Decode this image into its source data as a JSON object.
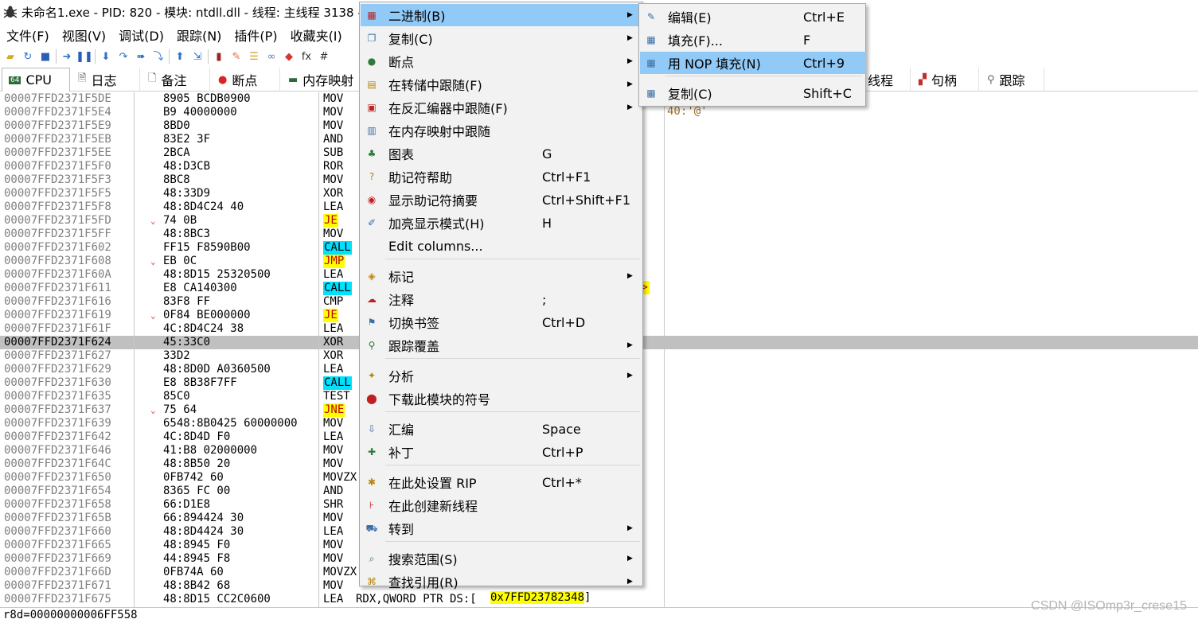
{
  "window": {
    "title": "未命名1.exe - PID: 820 - 模块: ntdll.dll - 线程: 主线程 3138 -",
    "icon": "bug-icon"
  },
  "menubar": [
    "文件(F)",
    "视图(V)",
    "调试(D)",
    "跟踪(N)",
    "插件(P)",
    "收藏夹(I)"
  ],
  "toolbar": [
    {
      "icon": "open-folder-icon",
      "glyph": "▰",
      "color": "#d9a82b"
    },
    {
      "icon": "restart-icon",
      "glyph": "↻",
      "color": "#2a73c9"
    },
    {
      "icon": "stop-icon",
      "glyph": "■",
      "color": "#2a5fb6"
    },
    {
      "icon": "run-icon",
      "glyph": "➜",
      "color": "#2a73c9"
    },
    {
      "icon": "pause-icon",
      "glyph": "❚❚",
      "color": "#2a5fb6"
    },
    {
      "icon": "step-into-icon",
      "glyph": "⬇",
      "color": "#2a73c9"
    },
    {
      "icon": "step-over-icon",
      "glyph": "↷",
      "color": "#2a73c9"
    },
    {
      "icon": "trace-into-icon",
      "glyph": "➠",
      "color": "#2a73c9"
    },
    {
      "icon": "trace-over-icon",
      "glyph": "⤵",
      "color": "#2a73c9"
    },
    {
      "icon": "execute-till-return-icon",
      "glyph": "⬆",
      "color": "#2a73c9"
    },
    {
      "icon": "run-to-user-code-icon",
      "glyph": "⇲",
      "color": "#2a73c9"
    },
    {
      "icon": "script-icon",
      "glyph": "▮",
      "color": "#a22222"
    },
    {
      "icon": "patch-icon",
      "glyph": "✎",
      "color": "#e06d4a"
    },
    {
      "icon": "comment-icon",
      "glyph": "☰",
      "color": "#d69e27"
    },
    {
      "icon": "link-icon",
      "glyph": "∞",
      "color": "#5a7fa8"
    },
    {
      "icon": "breakpoint-tag-icon",
      "glyph": "◆",
      "color": "#d93333"
    },
    {
      "icon": "function-icon",
      "glyph": "fx",
      "color": "#333333"
    },
    {
      "icon": "hash-icon",
      "glyph": "#",
      "color": "#333333"
    }
  ],
  "tabs": {
    "cpu": {
      "label": "CPU",
      "icon": "cpu-icon"
    },
    "log": {
      "label": "日志",
      "icon": "log-icon"
    },
    "notes": {
      "label": "备注",
      "icon": "notes-icon"
    },
    "breakpoints": {
      "label": "断点",
      "icon": "breakpoint-icon"
    },
    "memory_map": {
      "label": "内存映射",
      "icon": "memory-map-icon"
    },
    "threads": {
      "label": "线程",
      "icon": "threads-icon"
    },
    "handles": {
      "label": "句柄",
      "icon": "handles-icon"
    },
    "trace": {
      "label": "跟踪",
      "icon": "trace-icon"
    }
  },
  "disassembly": {
    "rows": [
      {
        "address": "00007FFD2371F5DE",
        "bytes": "8905 BCDB0900",
        "mnemonic": "MOV"
      },
      {
        "address": "00007FFD2371F5E4",
        "bytes": "B9 40000000",
        "mnemonic": "MOV"
      },
      {
        "address": "00007FFD2371F5E9",
        "bytes": "8BD0",
        "mnemonic": "MOV"
      },
      {
        "address": "00007FFD2371F5EB",
        "bytes": "83E2 3F",
        "mnemonic": "AND"
      },
      {
        "address": "00007FFD2371F5EE",
        "bytes": "2BCA",
        "mnemonic": "SUB"
      },
      {
        "address": "00007FFD2371F5F0",
        "bytes": "48:D3CB",
        "mnemonic": "ROR"
      },
      {
        "address": "00007FFD2371F5F3",
        "bytes": "8BC8",
        "mnemonic": "MOV"
      },
      {
        "address": "00007FFD2371F5F5",
        "bytes": "48:33D9",
        "mnemonic": "XOR"
      },
      {
        "address": "00007FFD2371F5F8",
        "bytes": "48:8D4C24 40",
        "mnemonic": "LEA"
      },
      {
        "address": "00007FFD2371F5FD",
        "bytes": "74 0B",
        "mnemonic": "JE",
        "jump": true,
        "style": "yellow"
      },
      {
        "address": "00007FFD2371F5FF",
        "bytes": "48:8BC3",
        "mnemonic": "MOV"
      },
      {
        "address": "00007FFD2371F602",
        "bytes": "FF15 F8590B00",
        "mnemonic": "CALL",
        "style": "cyan"
      },
      {
        "address": "00007FFD2371F608",
        "bytes": "EB 0C",
        "mnemonic": "JMP",
        "jump": true,
        "style": "yellow"
      },
      {
        "address": "00007FFD2371F60A",
        "bytes": "48:8D15 25320500",
        "mnemonic": "LEA"
      },
      {
        "address": "00007FFD2371F611",
        "bytes": "E8 CA140300",
        "mnemonic": "CALL",
        "style": "cyan"
      },
      {
        "address": "00007FFD2371F616",
        "bytes": "83F8 FF",
        "mnemonic": "CMP"
      },
      {
        "address": "00007FFD2371F619",
        "bytes": "0F84 BE000000",
        "mnemonic": "JE",
        "jump": true,
        "style": "yellow"
      },
      {
        "address": "00007FFD2371F61F",
        "bytes": "4C:8D4C24 38",
        "mnemonic": "LEA"
      },
      {
        "address": "00007FFD2371F624",
        "bytes": "45:33C0",
        "mnemonic": "XOR",
        "selected": true
      },
      {
        "address": "00007FFD2371F627",
        "bytes": "33D2",
        "mnemonic": "XOR"
      },
      {
        "address": "00007FFD2371F629",
        "bytes": "48:8D0D A0360500",
        "mnemonic": "LEA"
      },
      {
        "address": "00007FFD2371F630",
        "bytes": "E8 8B38F7FF",
        "mnemonic": "CALL",
        "style": "cyan"
      },
      {
        "address": "00007FFD2371F635",
        "bytes": "85C0",
        "mnemonic": "TEST"
      },
      {
        "address": "00007FFD2371F637",
        "bytes": "75 64",
        "mnemonic": "JNE",
        "jump": true,
        "style": "yellow"
      },
      {
        "address": "00007FFD2371F639",
        "bytes": "6548:8B0425 60000000",
        "mnemonic": "MOV"
      },
      {
        "address": "00007FFD2371F642",
        "bytes": "4C:8D4D F0",
        "mnemonic": "LEA"
      },
      {
        "address": "00007FFD2371F646",
        "bytes": "41:B8 02000000",
        "mnemonic": "MOV"
      },
      {
        "address": "00007FFD2371F64C",
        "bytes": "48:8B50 20",
        "mnemonic": "MOV"
      },
      {
        "address": "00007FFD2371F650",
        "bytes": "0FB742 60",
        "mnemonic": "MOVZX"
      },
      {
        "address": "00007FFD2371F654",
        "bytes": "8365 FC 00",
        "mnemonic": "AND"
      },
      {
        "address": "00007FFD2371F658",
        "bytes": "66:D1E8",
        "mnemonic": "SHR"
      },
      {
        "address": "00007FFD2371F65B",
        "bytes": "66:894424 30",
        "mnemonic": "MOV"
      },
      {
        "address": "00007FFD2371F660",
        "bytes": "48:8D4424 30",
        "mnemonic": "LEA"
      },
      {
        "address": "00007FFD2371F665",
        "bytes": "48:8945 F0",
        "mnemonic": "MOV"
      },
      {
        "address": "00007FFD2371F669",
        "bytes": "44:8945 F8",
        "mnemonic": "MOV"
      },
      {
        "address": "00007FFD2371F66D",
        "bytes": "0FB74A 60",
        "mnemonic": "MOVZX"
      },
      {
        "address": "00007FFD2371F671",
        "bytes": "48:8B42 68",
        "mnemonic": "MOV"
      },
      {
        "address": "00007FFD2371F675",
        "bytes": "48:8D15 CC2C0600",
        "mnemonic": "LEA"
      }
    ],
    "last_row_operand": "RDX,QWORD PTR DS:[",
    "last_row_pointer": "0x7FFD23782348",
    "last_row_close": "]",
    "comment": "40:'@'",
    "arrow_mark": ">"
  },
  "context_menu": {
    "items": [
      {
        "icon": "binary-icon",
        "glyph": "▦",
        "label": "二进制(B)",
        "shortcut": "",
        "submenu": true,
        "highlighted": true
      },
      {
        "icon": "copy-icon",
        "glyph": "❐",
        "label": "复制(C)",
        "shortcut": "",
        "submenu": true
      },
      {
        "icon": "breakpoint-dot-icon",
        "glyph": "●",
        "label": "断点",
        "shortcut": "",
        "submenu": true
      },
      {
        "icon": "follow-dump-icon",
        "glyph": "▤",
        "label": "在转储中跟随(F)",
        "shortcut": "",
        "submenu": true
      },
      {
        "icon": "follow-disasm-icon",
        "glyph": "▣",
        "label": "在反汇编器中跟随(F)",
        "shortcut": "",
        "submenu": true
      },
      {
        "icon": "follow-memmap-icon",
        "glyph": "▥",
        "label": "在内存映射中跟随",
        "shortcut": "",
        "submenu": false
      },
      {
        "icon": "graph-icon",
        "glyph": "♣",
        "label": "图表",
        "shortcut": "G",
        "submenu": false
      },
      {
        "icon": "help-icon",
        "glyph": "?",
        "label": "助记符帮助",
        "shortcut": "Ctrl+F1",
        "submenu": false
      },
      {
        "icon": "mnemonic-brief-icon",
        "glyph": "◉",
        "label": "显示助记符摘要",
        "shortcut": "Ctrl+Shift+F1",
        "submenu": false
      },
      {
        "icon": "highlight-icon",
        "glyph": "✐",
        "label": "加亮显示模式(H)",
        "shortcut": "H",
        "submenu": false
      },
      {
        "icon": "",
        "glyph": "",
        "label": "Edit columns...",
        "shortcut": "",
        "submenu": false
      },
      {
        "icon": "label-icon",
        "glyph": "◈",
        "label": "标记",
        "shortcut": "",
        "submenu": true
      },
      {
        "icon": "comment-bubble-icon",
        "glyph": "☁",
        "label": "注释",
        "shortcut": ";",
        "submenu": false
      },
      {
        "icon": "bookmark-icon",
        "glyph": "⚑",
        "label": "切换书签",
        "shortcut": "Ctrl+D",
        "submenu": false
      },
      {
        "icon": "trace-coverage-icon",
        "glyph": "⚲",
        "label": "跟踪覆盖",
        "shortcut": "",
        "submenu": true
      },
      {
        "icon": "analysis-icon",
        "glyph": "✦",
        "label": "分析",
        "shortcut": "",
        "submenu": true
      },
      {
        "icon": "download-symbols-icon",
        "glyph": "⬤",
        "label": "下载此模块的符号",
        "shortcut": "",
        "submenu": false
      },
      {
        "icon": "assemble-icon",
        "glyph": "⇩",
        "label": "汇编",
        "shortcut": "Space",
        "submenu": false
      },
      {
        "icon": "patch-bandage-icon",
        "glyph": "✚",
        "label": "补丁",
        "shortcut": "Ctrl+P",
        "submenu": false
      },
      {
        "icon": "set-rip-icon",
        "glyph": "✱",
        "label": "在此处设置 RIP",
        "shortcut": "Ctrl+*",
        "submenu": false
      },
      {
        "icon": "new-thread-icon",
        "glyph": "⊦",
        "label": "在此创建新线程",
        "shortcut": "",
        "submenu": false
      },
      {
        "icon": "goto-icon",
        "glyph": "⛟",
        "label": "转到",
        "shortcut": "",
        "submenu": true
      },
      {
        "icon": "search-icon",
        "glyph": "⌕",
        "label": "搜索范围(S)",
        "shortcut": "",
        "submenu": true
      },
      {
        "icon": "find-references-icon",
        "glyph": "⌘",
        "label": "查找引用(R)",
        "shortcut": "",
        "submenu": true
      }
    ]
  },
  "binary_submenu": {
    "items": [
      {
        "icon": "edit-binary-icon",
        "glyph": "✎",
        "label": "编辑(E)",
        "shortcut": "Ctrl+E"
      },
      {
        "icon": "fill-icon",
        "glyph": "▦",
        "label": "填充(F)...",
        "shortcut": "F"
      },
      {
        "icon": "fill-nop-icon",
        "glyph": "▦",
        "label": "用 NOP 填充(N)",
        "shortcut": "Ctrl+9",
        "highlighted": true
      },
      {
        "icon": "copy-binary-icon",
        "glyph": "▦",
        "label": "复制(C)",
        "shortcut": "Shift+C"
      }
    ]
  },
  "statusbar": {
    "text": "r8d=00000000006FF558"
  },
  "watermark": "CSDN @ISOmp3r_crese15"
}
